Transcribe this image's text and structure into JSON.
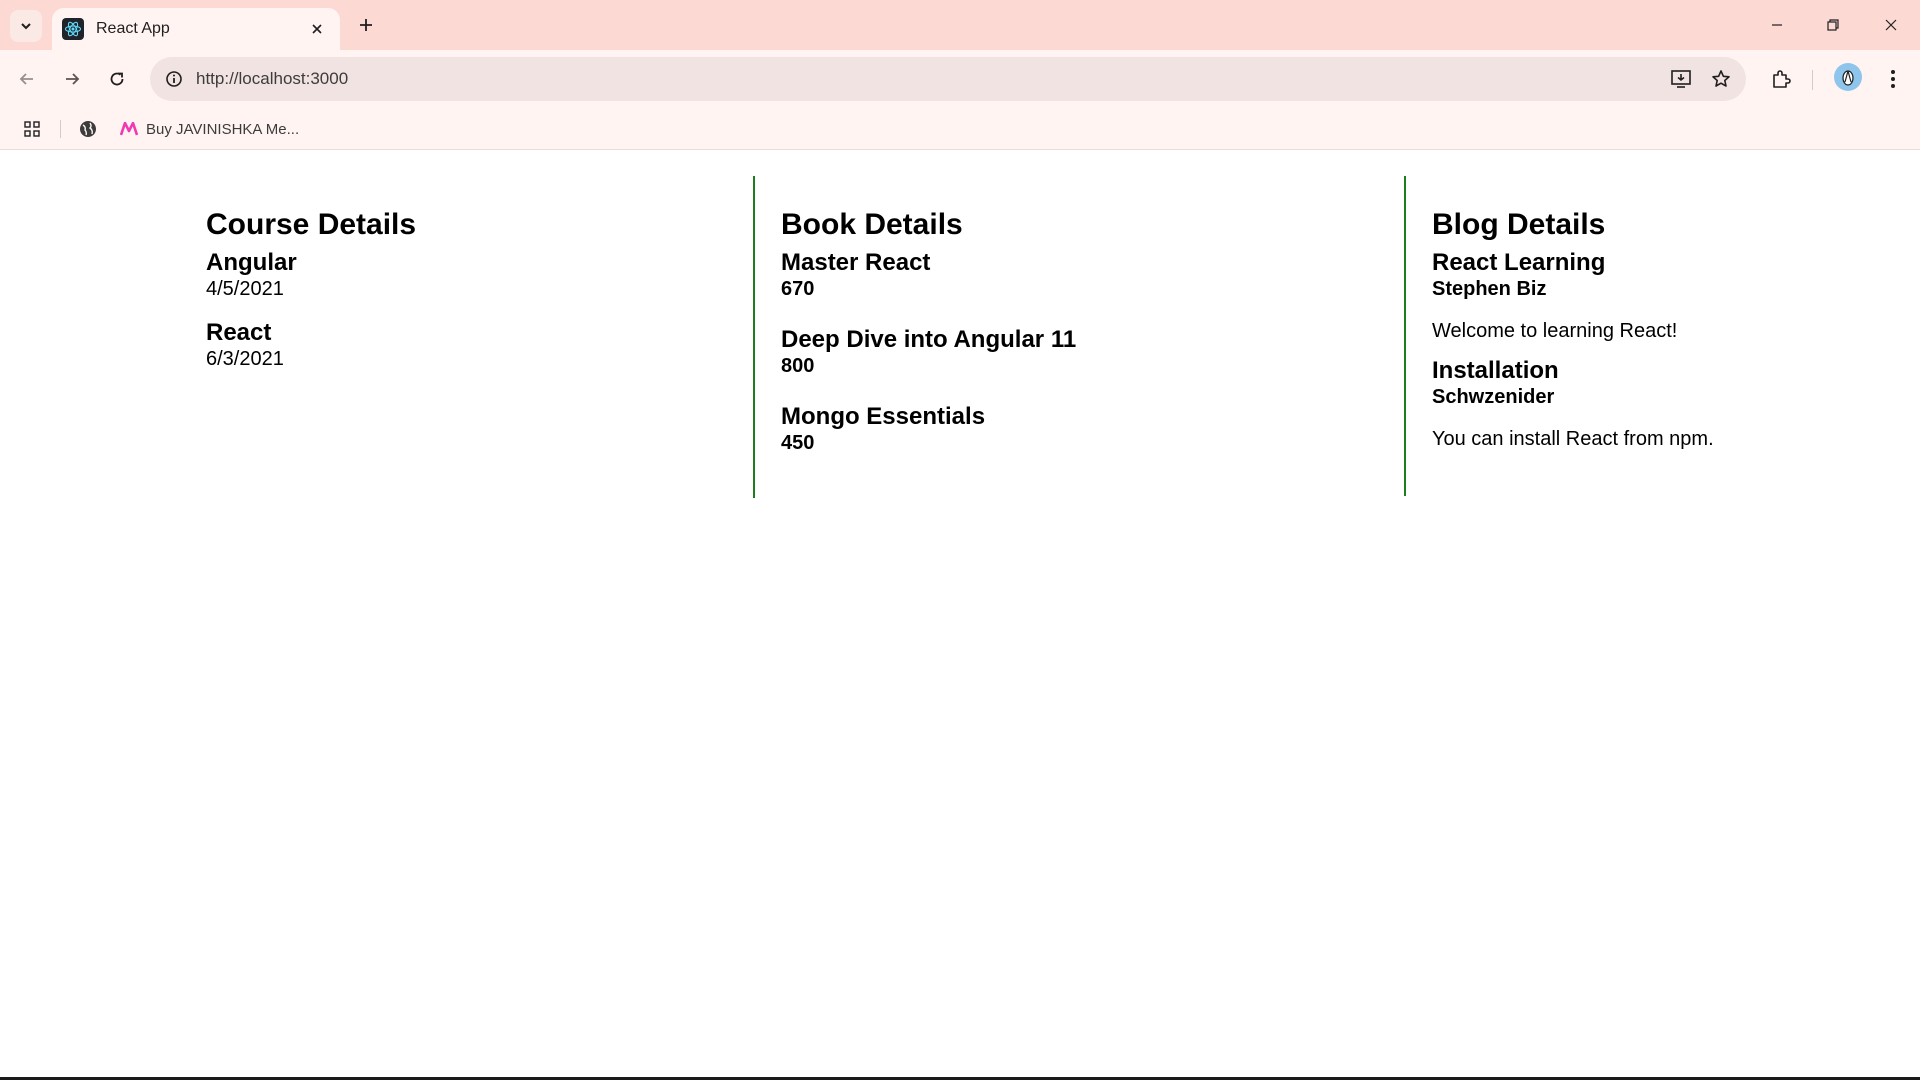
{
  "browser": {
    "tab": {
      "title": "React App"
    },
    "address": {
      "url": "http://localhost:3000"
    },
    "bookmarks": [
      {
        "label": "Buy JAVINISHKA Me..."
      }
    ],
    "icons": {
      "tab_search": "chevron-down-icon",
      "favicon": "react-logo-icon",
      "close": "close-icon",
      "new_tab": "plus-icon",
      "back": "arrow-left-icon",
      "forward": "arrow-right-icon",
      "reload": "reload-icon",
      "site_info": "info-icon",
      "install": "install-app-icon",
      "bookmark": "star-icon",
      "extensions": "puzzle-icon",
      "menu": "kebab-menu-icon"
    }
  },
  "course": {
    "heading": "Course Details",
    "items": [
      {
        "name": "Angular",
        "date": "4/5/2021"
      },
      {
        "name": "React",
        "date": "6/3/2021"
      }
    ]
  },
  "book": {
    "heading": "Book Details",
    "items": [
      {
        "name": "Master React",
        "price": "670"
      },
      {
        "name": "Deep Dive into Angular 11",
        "price": "800"
      },
      {
        "name": "Mongo Essentials",
        "price": "450"
      }
    ]
  },
  "blog": {
    "heading": "Blog Details",
    "items": [
      {
        "title": "React Learning",
        "author": "Stephen Biz",
        "body": "Welcome to learning React!"
      },
      {
        "title": "Installation",
        "author": "Schwzenider",
        "body": "You can install React from npm."
      }
    ]
  },
  "colors": {
    "divider": "#1e7d1e",
    "chrome_tabstrip": "#fdd9d3",
    "chrome_toolbar": "#fff4f2"
  }
}
